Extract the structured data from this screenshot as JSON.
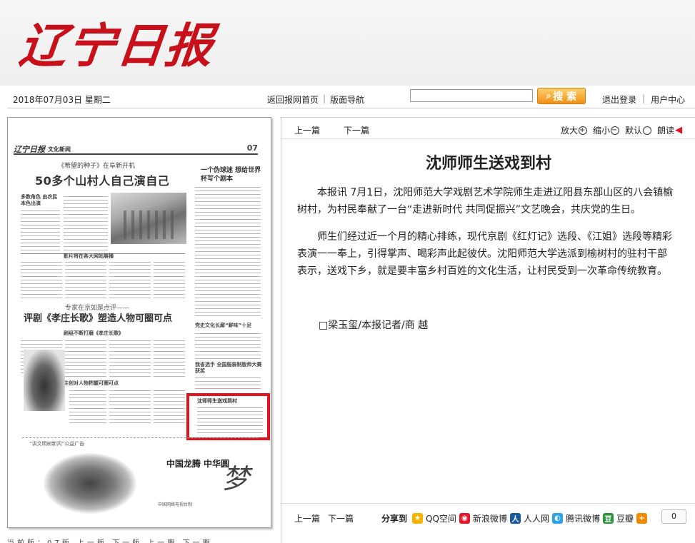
{
  "header": {
    "logo_text": "辽宁日报"
  },
  "topbar": {
    "date": "2018年07月03日 星期二",
    "nav": [
      "返回报网首页",
      "版面导航"
    ],
    "search_placeholder": "",
    "search_label": "搜 索",
    "user": [
      "退出登录",
      "用户中心"
    ]
  },
  "page_preview": {
    "masthead": "辽宁日报",
    "section": "文化新闻",
    "page_number": "07",
    "sub_headline_1": "《希望的种子》在阜新开机",
    "headline_1": "50多个山村人自己演自己",
    "side_headline": "一个伪球迷 想给世界杯写个剧本",
    "small_1": "多数角色 由农民本色出演",
    "small_2": "影片将在各大网站展播",
    "sub_headline_2": "专家在京如是点评——",
    "headline_2": "评剧《孝庄长歌》塑造人物可圈可点",
    "small_3": "剧组不断打磨《孝庄长歌》",
    "small_4": "主创对人物把握可圈可点",
    "small_5": "党史文化长廊“鲜味”十足",
    "small_6": "我省选手 全国服装制版师大赛获奖",
    "highlighted_title": "沈师师生送戏到村",
    "ad_caption": "“讲文明树新风”公益广告",
    "ad_title": "中国龙腾 中华圆",
    "ad_brush": "梦",
    "ad_footer": "中国网络电视台制"
  },
  "bottom_strip": "当前版：07版 上一版 下一版 上一期 下一期",
  "article": {
    "toolbar": {
      "prev": "上一篇",
      "next": "下一篇",
      "zoom_in": "放大",
      "zoom_out": "缩小",
      "default": "默认",
      "read": "朗读"
    },
    "title": "沈师师生送戏到村",
    "paragraphs": [
      "本报讯 7月1日，沈阳师范大学戏剧艺术学院师生走进辽阳县东部山区的八会镇榆树村，为村民奉献了一台“走进新时代 共同促振兴”文艺晚会，共庆党的生日。",
      "师生们经过近一个月的精心排练，现代京剧《红灯记》选段、《江姐》选段等精彩表演一一奉上，引得掌声、喝彩声此起彼伏。沈阳师范大学选派到榆树村的驻村干部表示，送戏下乡，就是要丰富乡村百姓的文化生活，让村民受到一次革命传统教育。"
    ],
    "author": "□梁玉玺/本报记者/商 越",
    "bottom": {
      "prev": "上一篇",
      "next": "下一篇",
      "share_label": "分享到",
      "share_items": [
        "QQ空间",
        "新浪微博",
        "人人网",
        "腾讯微博",
        "豆瓣"
      ],
      "count": "0"
    }
  }
}
